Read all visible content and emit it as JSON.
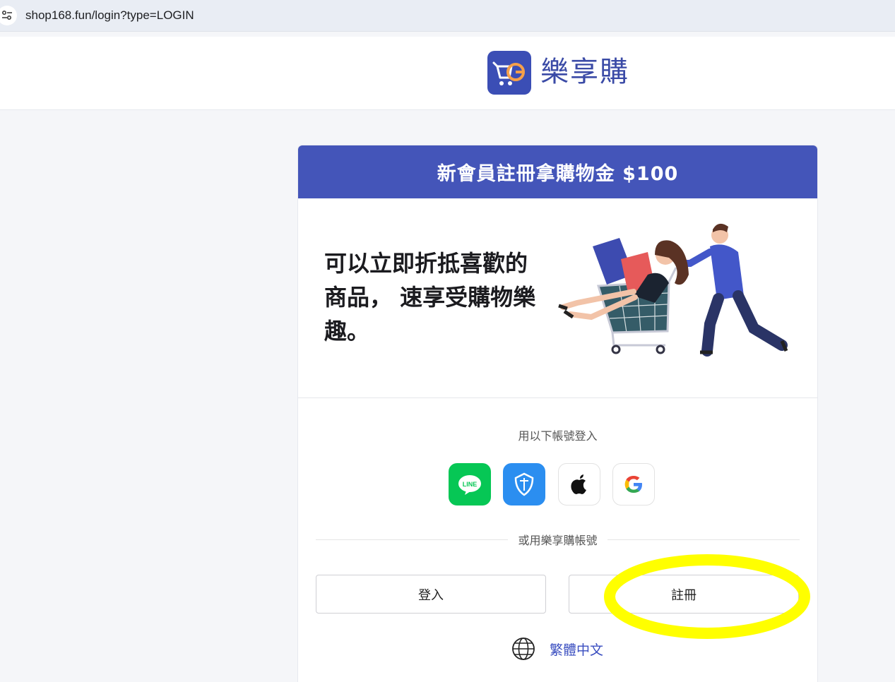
{
  "browser": {
    "url": "shop168.fun/login?type=LOGIN",
    "site_icon": "tune-icon"
  },
  "header": {
    "brand_name": "樂享購",
    "logo_icon": "go-cart-logo"
  },
  "card": {
    "banner": "新會員註冊拿購物金 $100",
    "hero_text": "可以立即折抵喜歡的商品， 速享受購物樂趣。",
    "illustration": "shopping-cart-couple-illustration",
    "login_with_label": "用以下帳號登入",
    "social_logins": [
      {
        "name": "line",
        "label": "LINE",
        "color": "#06c755"
      },
      {
        "name": "shield",
        "color": "#2b8ef0"
      },
      {
        "name": "apple",
        "color": "#ffffff"
      },
      {
        "name": "google",
        "color": "#ffffff"
      }
    ],
    "or_label": "或用樂享購帳號",
    "login_button": "登入",
    "register_button": "註冊",
    "language": "繁體中文"
  },
  "colors": {
    "primary": "#4455b9",
    "highlight": "#ffff00"
  }
}
